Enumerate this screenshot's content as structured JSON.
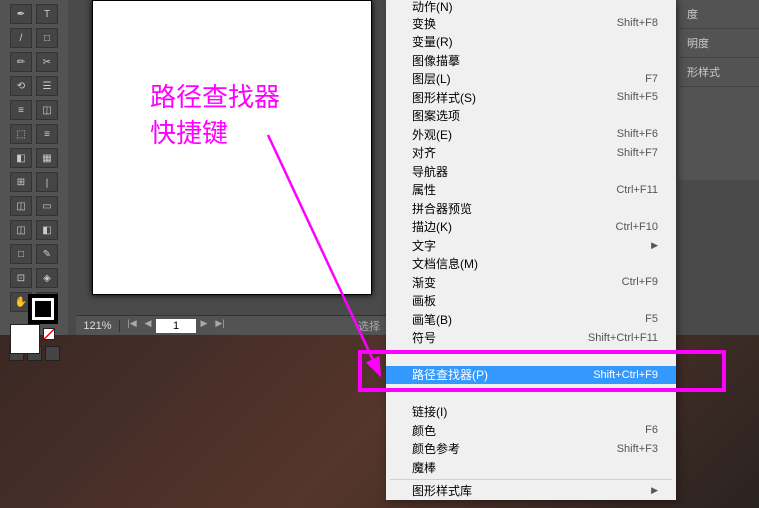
{
  "annotation": {
    "line1": "路径查找器",
    "line2": "快捷键"
  },
  "zoom": "121%",
  "page_current": "1",
  "selection_text": "选择",
  "right_panels": [
    "度",
    "明度",
    "形样式"
  ],
  "menu_items": [
    {
      "label": "动作(N)",
      "shortcut": "",
      "sep": false
    },
    {
      "label": "变换",
      "shortcut": "Shift+F8",
      "sep": false
    },
    {
      "label": "变量(R)",
      "shortcut": "",
      "sep": false
    },
    {
      "label": "图像描摹",
      "shortcut": "",
      "sep": false
    },
    {
      "label": "图层(L)",
      "shortcut": "F7",
      "sep": false
    },
    {
      "label": "图形样式(S)",
      "shortcut": "Shift+F5",
      "sep": false
    },
    {
      "label": "图案选项",
      "shortcut": "",
      "sep": false
    },
    {
      "label": "外观(E)",
      "shortcut": "Shift+F6",
      "sep": false
    },
    {
      "label": "对齐",
      "shortcut": "Shift+F7",
      "sep": false
    },
    {
      "label": "导航器",
      "shortcut": "",
      "sep": false
    },
    {
      "label": "属性",
      "shortcut": "Ctrl+F11",
      "sep": false
    },
    {
      "label": "拼合器预览",
      "shortcut": "",
      "sep": false
    },
    {
      "label": "描边(K)",
      "shortcut": "Ctrl+F10",
      "sep": false
    },
    {
      "label": "文字",
      "shortcut": "",
      "arrow": true,
      "sep": false
    },
    {
      "label": "文档信息(M)",
      "shortcut": "",
      "sep": false
    },
    {
      "label": "渐变",
      "shortcut": "Ctrl+F9",
      "sep": false
    },
    {
      "label": "画板",
      "shortcut": "",
      "sep": false
    },
    {
      "label": "画笔(B)",
      "shortcut": "F5",
      "sep": false
    },
    {
      "label": "符号",
      "shortcut": "Shift+Ctrl+F11",
      "sep": false
    },
    {
      "label": "",
      "shortcut": "",
      "sep": false,
      "obscured": true
    },
    {
      "label": "路径查找器(P)",
      "shortcut": "Shift+Ctrl+F9",
      "sep": false,
      "highlighted": true
    },
    {
      "label": "",
      "shortcut": "",
      "sep": false,
      "obscured": true
    },
    {
      "label": "链接(I)",
      "shortcut": "",
      "sep": false
    },
    {
      "label": "颜色",
      "shortcut": "F6",
      "sep": false
    },
    {
      "label": "颜色参考",
      "shortcut": "Shift+F3",
      "sep": false
    },
    {
      "label": "魔棒",
      "shortcut": "",
      "sep": false
    },
    {
      "sep": true
    },
    {
      "label": "图形样式库",
      "shortcut": "",
      "arrow": true,
      "sep": false
    }
  ],
  "tool_icons": [
    "✒",
    "T",
    "/",
    "□",
    "✏",
    "✂",
    "⟲",
    "☰",
    "≡",
    "◫",
    "⬚",
    "≡",
    "◧",
    "▦",
    "⊞",
    "丨",
    "◫",
    "▭",
    "◫",
    "◧",
    "□",
    "✎",
    "⊡",
    "◈",
    "✋",
    "🔍"
  ]
}
